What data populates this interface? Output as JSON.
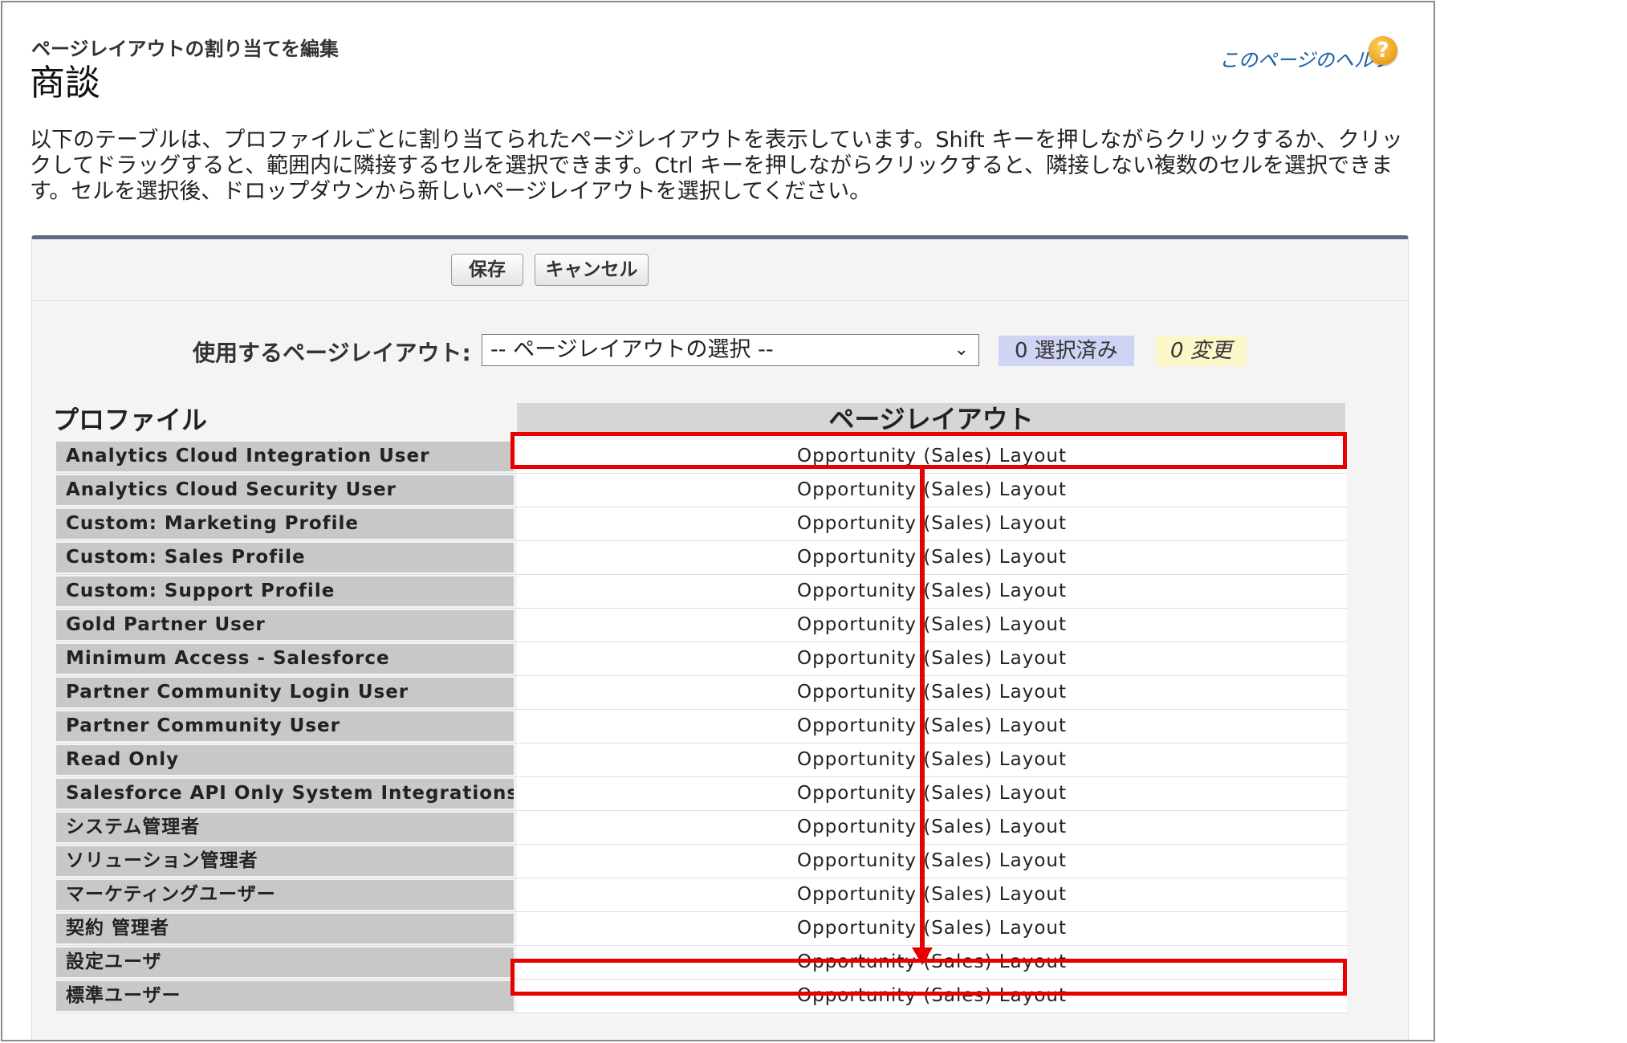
{
  "header": {
    "subtitle": "ページレイアウトの割り当てを編集",
    "title": "商談",
    "help_link": "このページのヘルプ",
    "help_icon": "?"
  },
  "description": "以下のテーブルは、プロファイルごとに割り当てられたページレイアウトを表示しています。Shift キーを押しながらクリックするか、クリックしてドラッグすると、範囲内に隣接するセルを選択できます。Ctrl キーを押しながらクリックすると、隣接しない複数のセルを選択できます。セルを選択後、ドロップダウンから新しいページレイアウトを選択してください。",
  "toolbar": {
    "save_label": "保存",
    "cancel_label": "キャンセル"
  },
  "layout_picker": {
    "label": "使用するページレイアウト:",
    "selected": "-- ページレイアウトの選択 --",
    "selected_count": "0 選択済み",
    "changed_count": "0 変更"
  },
  "table": {
    "col_profile": "プロファイル",
    "col_layout": "ページレイアウト",
    "rows": [
      {
        "profile": "Analytics Cloud Integration User",
        "layout": "Opportunity (Sales) Layout"
      },
      {
        "profile": "Analytics Cloud Security User",
        "layout": "Opportunity (Sales) Layout"
      },
      {
        "profile": "Custom: Marketing Profile",
        "layout": "Opportunity (Sales) Layout"
      },
      {
        "profile": "Custom: Sales Profile",
        "layout": "Opportunity (Sales) Layout"
      },
      {
        "profile": "Custom: Support Profile",
        "layout": "Opportunity (Sales) Layout"
      },
      {
        "profile": "Gold Partner User",
        "layout": "Opportunity (Sales) Layout"
      },
      {
        "profile": "Minimum Access - Salesforce",
        "layout": "Opportunity (Sales) Layout"
      },
      {
        "profile": "Partner Community Login User",
        "layout": "Opportunity (Sales) Layout"
      },
      {
        "profile": "Partner Community User",
        "layout": "Opportunity (Sales) Layout"
      },
      {
        "profile": "Read Only",
        "layout": "Opportunity (Sales) Layout"
      },
      {
        "profile": "Salesforce API Only System Integrations",
        "layout": "Opportunity (Sales) Layout"
      },
      {
        "profile": "システム管理者",
        "layout": "Opportunity (Sales) Layout"
      },
      {
        "profile": "ソリューション管理者",
        "layout": "Opportunity (Sales) Layout"
      },
      {
        "profile": "マーケティングユーザー",
        "layout": "Opportunity (Sales) Layout"
      },
      {
        "profile": "契約 管理者",
        "layout": "Opportunity (Sales) Layout"
      },
      {
        "profile": "設定ユーザ",
        "layout": "Opportunity (Sales) Layout"
      },
      {
        "profile": "標準ユーザー",
        "layout": "Opportunity (Sales) Layout"
      }
    ]
  },
  "annotation": {
    "highlight_color": "#e60000"
  }
}
